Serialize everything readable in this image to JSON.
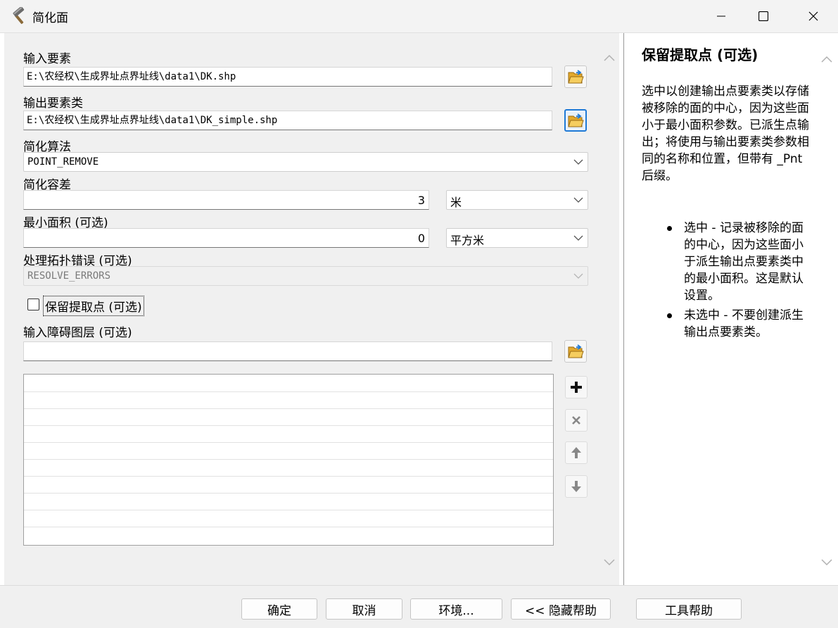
{
  "window": {
    "title": "简化面",
    "app_icon": "hammer-icon"
  },
  "form": {
    "input_features": {
      "label": "输入要素",
      "value": "E:\\农经权\\生成界址点界址线\\data1\\DK.shp"
    },
    "output_feature_class": {
      "label": "输出要素类",
      "value": "E:\\农经权\\生成界址点界址线\\data1\\DK_simple.shp"
    },
    "algorithm": {
      "label": "简化算法",
      "value": "POINT_REMOVE"
    },
    "tolerance": {
      "label": "简化容差",
      "value": "3",
      "unit": "米"
    },
    "min_area": {
      "label": "最小面积 (可选)",
      "value": "0",
      "unit": "平方米"
    },
    "topology_errors": {
      "label": "处理拓扑错误 (可选)",
      "value": "RESOLVE_ERRORS"
    },
    "keep_collapsed_points": {
      "label": "保留提取点 (可选)",
      "checked": false
    },
    "barriers": {
      "label": "输入障碍图层 (可选)",
      "value": ""
    }
  },
  "help": {
    "title": "保留提取点 (可选)",
    "body": "选中以创建输出点要素类以存储被移除的面的中心，因为这些面小于最小面积参数。已派生点输出；将使用与输出要素类参数相同的名称和位置，但带有 _Pnt 后缀。",
    "bullets": [
      "选中 - 记录被移除的面的中心，因为这些面小于派生输出点要素类中的最小面积。这是默认设置。",
      "未选中 - 不要创建派生输出点要素类。"
    ]
  },
  "buttons": {
    "ok": "确定",
    "cancel": "取消",
    "environments": "环境...",
    "hide_help": "<< 隐藏帮助",
    "tool_help": "工具帮助"
  },
  "colors": {
    "accent": "#1f7ad6",
    "pane_bg": "#f0f0f0",
    "titlebar_bg": "#f3f3f3"
  }
}
